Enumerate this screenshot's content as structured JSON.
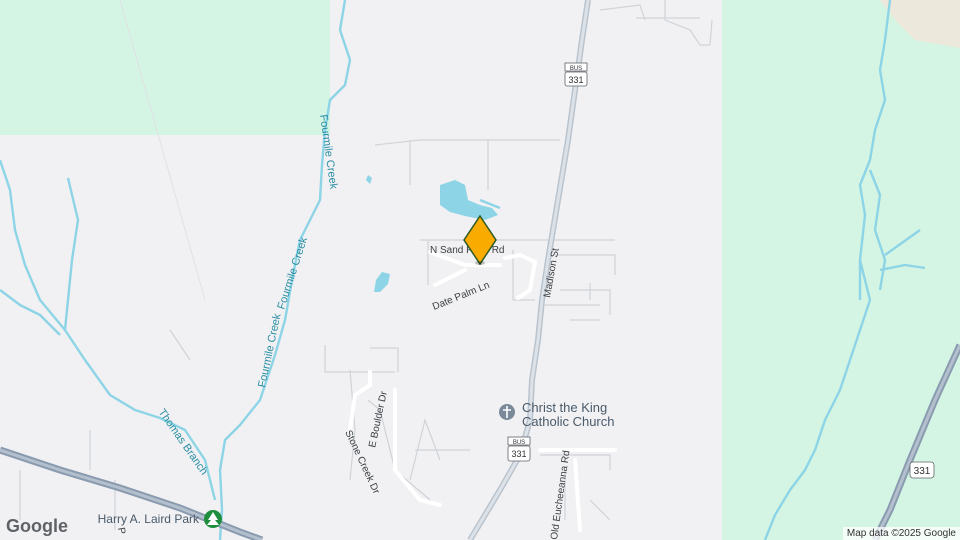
{
  "map": {
    "roads": {
      "madison_st": "Madison St",
      "n_sand_palm_rd": "N Sand Palm Rd",
      "date_palm_ln": "Date Palm Ln",
      "e_boulder_dr": "E Boulder Dr",
      "stone_creek_dr": "Stone Creek Dr",
      "old_eucheeanna_rd": "Old Eucheeanna Rd"
    },
    "water": {
      "fourmile_creek": "Fourmile Creek",
      "thomas_branch": "Thomas Branch"
    },
    "pois": {
      "church_line1": "Christ the King",
      "church_line2": "Catholic Church",
      "park": "Harry A. Laird Park"
    },
    "shields": {
      "bus_331_top_bus": "BUS",
      "bus_331_top_num": "331",
      "bus_331_bottom_bus": "BUS",
      "bus_331_bottom_num": "331",
      "us_331": "331"
    },
    "marker_color": "#f9ab00",
    "colors": {
      "land": "#f1f1f3",
      "green": "#d4f5e4",
      "water": "#8cd4e6",
      "highway": "#8a9bb0",
      "sand": "#ede8dc"
    }
  },
  "google_logo": "Google",
  "attribution": "Map data ©2025 Google"
}
